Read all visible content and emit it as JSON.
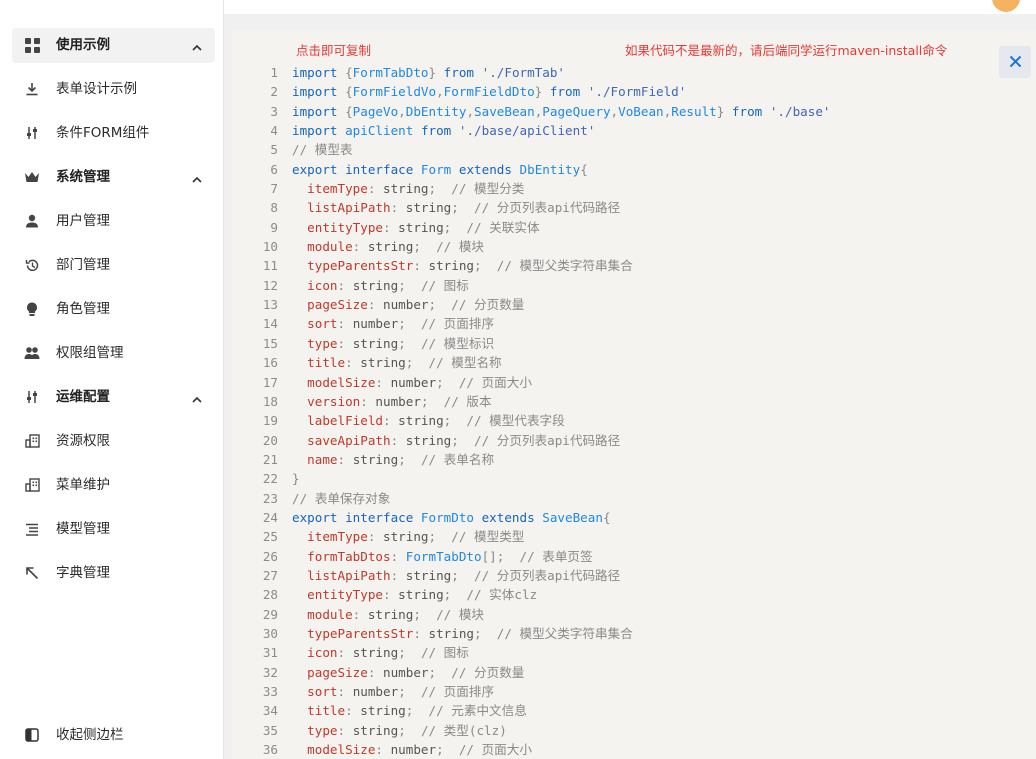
{
  "sidebar": {
    "items": [
      {
        "label": "使用示例",
        "icon": "dashboard-icon",
        "type": "group",
        "active": true
      },
      {
        "label": "表单设计示例",
        "icon": "download-icon",
        "type": "item"
      },
      {
        "label": "条件FORM组件",
        "icon": "slider-icon",
        "type": "item"
      },
      {
        "label": "系统管理",
        "icon": "crown-icon",
        "type": "group"
      },
      {
        "label": "用户管理",
        "icon": "user-icon",
        "type": "item"
      },
      {
        "label": "部门管理",
        "icon": "history-icon",
        "type": "item"
      },
      {
        "label": "角色管理",
        "icon": "bulb-icon",
        "type": "item"
      },
      {
        "label": "权限组管理",
        "icon": "team-icon",
        "type": "item"
      },
      {
        "label": "运维配置",
        "icon": "slider-icon",
        "type": "group"
      },
      {
        "label": "资源权限",
        "icon": "building-icon",
        "type": "item"
      },
      {
        "label": "菜单维护",
        "icon": "building-icon",
        "type": "item"
      },
      {
        "label": "模型管理",
        "icon": "list-icon",
        "type": "item"
      },
      {
        "label": "字典管理",
        "icon": "arrow-up-left-icon",
        "type": "item"
      }
    ],
    "collapse_label": "收起侧边栏"
  },
  "code_panel": {
    "copy_hint": "点击即可复制",
    "maven_hint": "如果代码不是最新的，请后端同学运行maven-install命令",
    "close_icon": "close-icon",
    "lines": [
      {
        "n": "1",
        "t": [
          [
            "kw",
            "import"
          ],
          [
            "pu",
            " {"
          ],
          [
            "ty",
            "FormTabDto"
          ],
          [
            "pu",
            "} "
          ],
          [
            "kw",
            "from"
          ],
          [
            "pl",
            " "
          ],
          [
            "str",
            "'./FormTab'"
          ]
        ]
      },
      {
        "n": "2",
        "t": [
          [
            "kw",
            "import"
          ],
          [
            "pu",
            " {"
          ],
          [
            "ty",
            "FormFieldVo"
          ],
          [
            "pu",
            ","
          ],
          [
            "ty",
            "FormFieldDto"
          ],
          [
            "pu",
            "} "
          ],
          [
            "kw",
            "from"
          ],
          [
            "pl",
            " "
          ],
          [
            "str",
            "'./FormField'"
          ]
        ]
      },
      {
        "n": "3",
        "t": [
          [
            "kw",
            "import"
          ],
          [
            "pu",
            " {"
          ],
          [
            "ty",
            "PageVo"
          ],
          [
            "pu",
            ","
          ],
          [
            "ty",
            "DbEntity"
          ],
          [
            "pu",
            ","
          ],
          [
            "ty",
            "SaveBean"
          ],
          [
            "pu",
            ","
          ],
          [
            "ty",
            "PageQuery"
          ],
          [
            "pu",
            ","
          ],
          [
            "ty",
            "VoBean"
          ],
          [
            "pu",
            ","
          ],
          [
            "ty",
            "Result"
          ],
          [
            "pu",
            "} "
          ],
          [
            "kw",
            "from"
          ],
          [
            "pl",
            " "
          ],
          [
            "str",
            "'./base'"
          ]
        ]
      },
      {
        "n": "4",
        "t": [
          [
            "kw",
            "import"
          ],
          [
            "pl",
            " "
          ],
          [
            "ty",
            "apiClient"
          ],
          [
            "pl",
            " "
          ],
          [
            "kw",
            "from"
          ],
          [
            "pl",
            " "
          ],
          [
            "str",
            "'./base/apiClient'"
          ]
        ]
      },
      {
        "n": "5",
        "t": [
          [
            "cm",
            "// 模型表"
          ]
        ]
      },
      {
        "n": "6",
        "t": [
          [
            "kw",
            "export interface"
          ],
          [
            "pl",
            " "
          ],
          [
            "ty",
            "Form"
          ],
          [
            "pl",
            " "
          ],
          [
            "kw",
            "extends"
          ],
          [
            "pl",
            " "
          ],
          [
            "ty",
            "DbEntity"
          ],
          [
            "pu",
            "{"
          ]
        ]
      },
      {
        "n": "7",
        "t": [
          [
            "pl",
            "  "
          ],
          [
            "pr",
            "itemType"
          ],
          [
            "pu",
            ": "
          ],
          [
            "pl",
            "string"
          ],
          [
            "pu",
            ";  "
          ],
          [
            "cm",
            "// 模型分类"
          ]
        ]
      },
      {
        "n": "8",
        "t": [
          [
            "pl",
            "  "
          ],
          [
            "pr",
            "listApiPath"
          ],
          [
            "pu",
            ": "
          ],
          [
            "pl",
            "string"
          ],
          [
            "pu",
            ";  "
          ],
          [
            "cm",
            "// 分页列表api代码路径"
          ]
        ]
      },
      {
        "n": "9",
        "t": [
          [
            "pl",
            "  "
          ],
          [
            "pr",
            "entityType"
          ],
          [
            "pu",
            ": "
          ],
          [
            "pl",
            "string"
          ],
          [
            "pu",
            ";  "
          ],
          [
            "cm",
            "// 关联实体"
          ]
        ]
      },
      {
        "n": "10",
        "t": [
          [
            "pl",
            "  "
          ],
          [
            "pr",
            "module"
          ],
          [
            "pu",
            ": "
          ],
          [
            "pl",
            "string"
          ],
          [
            "pu",
            ";  "
          ],
          [
            "cm",
            "// 模块"
          ]
        ]
      },
      {
        "n": "11",
        "t": [
          [
            "pl",
            "  "
          ],
          [
            "pr",
            "typeParentsStr"
          ],
          [
            "pu",
            ": "
          ],
          [
            "pl",
            "string"
          ],
          [
            "pu",
            ";  "
          ],
          [
            "cm",
            "// 模型父类字符串集合"
          ]
        ]
      },
      {
        "n": "12",
        "t": [
          [
            "pl",
            "  "
          ],
          [
            "pr",
            "icon"
          ],
          [
            "pu",
            ": "
          ],
          [
            "pl",
            "string"
          ],
          [
            "pu",
            ";  "
          ],
          [
            "cm",
            "// 图标"
          ]
        ]
      },
      {
        "n": "13",
        "t": [
          [
            "pl",
            "  "
          ],
          [
            "pr",
            "pageSize"
          ],
          [
            "pu",
            ": "
          ],
          [
            "pl",
            "number"
          ],
          [
            "pu",
            ";  "
          ],
          [
            "cm",
            "// 分页数量"
          ]
        ]
      },
      {
        "n": "14",
        "t": [
          [
            "pl",
            "  "
          ],
          [
            "pr",
            "sort"
          ],
          [
            "pu",
            ": "
          ],
          [
            "pl",
            "number"
          ],
          [
            "pu",
            ";  "
          ],
          [
            "cm",
            "// 页面排序"
          ]
        ]
      },
      {
        "n": "15",
        "t": [
          [
            "pl",
            "  "
          ],
          [
            "pr",
            "type"
          ],
          [
            "pu",
            ": "
          ],
          [
            "pl",
            "string"
          ],
          [
            "pu",
            ";  "
          ],
          [
            "cm",
            "// 模型标识"
          ]
        ]
      },
      {
        "n": "16",
        "t": [
          [
            "pl",
            "  "
          ],
          [
            "pr",
            "title"
          ],
          [
            "pu",
            ": "
          ],
          [
            "pl",
            "string"
          ],
          [
            "pu",
            ";  "
          ],
          [
            "cm",
            "// 模型名称"
          ]
        ]
      },
      {
        "n": "17",
        "t": [
          [
            "pl",
            "  "
          ],
          [
            "pr",
            "modelSize"
          ],
          [
            "pu",
            ": "
          ],
          [
            "pl",
            "number"
          ],
          [
            "pu",
            ";  "
          ],
          [
            "cm",
            "// 页面大小"
          ]
        ]
      },
      {
        "n": "18",
        "t": [
          [
            "pl",
            "  "
          ],
          [
            "pr",
            "version"
          ],
          [
            "pu",
            ": "
          ],
          [
            "pl",
            "number"
          ],
          [
            "pu",
            ";  "
          ],
          [
            "cm",
            "// 版本"
          ]
        ]
      },
      {
        "n": "19",
        "t": [
          [
            "pl",
            "  "
          ],
          [
            "pr",
            "labelField"
          ],
          [
            "pu",
            ": "
          ],
          [
            "pl",
            "string"
          ],
          [
            "pu",
            ";  "
          ],
          [
            "cm",
            "// 模型代表字段"
          ]
        ]
      },
      {
        "n": "20",
        "t": [
          [
            "pl",
            "  "
          ],
          [
            "pr",
            "saveApiPath"
          ],
          [
            "pu",
            ": "
          ],
          [
            "pl",
            "string"
          ],
          [
            "pu",
            ";  "
          ],
          [
            "cm",
            "// 分页列表api代码路径"
          ]
        ]
      },
      {
        "n": "21",
        "t": [
          [
            "pl",
            "  "
          ],
          [
            "pr",
            "name"
          ],
          [
            "pu",
            ": "
          ],
          [
            "pl",
            "string"
          ],
          [
            "pu",
            ";  "
          ],
          [
            "cm",
            "// 表单名称"
          ]
        ]
      },
      {
        "n": "22",
        "t": [
          [
            "pu",
            "}"
          ]
        ]
      },
      {
        "n": "23",
        "t": [
          [
            "cm",
            "// 表单保存对象"
          ]
        ]
      },
      {
        "n": "24",
        "t": [
          [
            "kw",
            "export interface"
          ],
          [
            "pl",
            " "
          ],
          [
            "ty",
            "FormDto"
          ],
          [
            "pl",
            " "
          ],
          [
            "kw",
            "extends"
          ],
          [
            "pl",
            " "
          ],
          [
            "ty",
            "SaveBean"
          ],
          [
            "pu",
            "{"
          ]
        ]
      },
      {
        "n": "25",
        "t": [
          [
            "pl",
            "  "
          ],
          [
            "pr",
            "itemType"
          ],
          [
            "pu",
            ": "
          ],
          [
            "pl",
            "string"
          ],
          [
            "pu",
            ";  "
          ],
          [
            "cm",
            "// 模型类型"
          ]
        ]
      },
      {
        "n": "26",
        "t": [
          [
            "pl",
            "  "
          ],
          [
            "pr",
            "formTabDtos"
          ],
          [
            "pu",
            ": "
          ],
          [
            "ty",
            "FormTabDto"
          ],
          [
            "pu",
            "[];  "
          ],
          [
            "cm",
            "// 表单页签"
          ]
        ]
      },
      {
        "n": "27",
        "t": [
          [
            "pl",
            "  "
          ],
          [
            "pr",
            "listApiPath"
          ],
          [
            "pu",
            ": "
          ],
          [
            "pl",
            "string"
          ],
          [
            "pu",
            ";  "
          ],
          [
            "cm",
            "// 分页列表api代码路径"
          ]
        ]
      },
      {
        "n": "28",
        "t": [
          [
            "pl",
            "  "
          ],
          [
            "pr",
            "entityType"
          ],
          [
            "pu",
            ": "
          ],
          [
            "pl",
            "string"
          ],
          [
            "pu",
            ";  "
          ],
          [
            "cm",
            "// 实体clz"
          ]
        ]
      },
      {
        "n": "29",
        "t": [
          [
            "pl",
            "  "
          ],
          [
            "pr",
            "module"
          ],
          [
            "pu",
            ": "
          ],
          [
            "pl",
            "string"
          ],
          [
            "pu",
            ";  "
          ],
          [
            "cm",
            "// 模块"
          ]
        ]
      },
      {
        "n": "30",
        "t": [
          [
            "pl",
            "  "
          ],
          [
            "pr",
            "typeParentsStr"
          ],
          [
            "pu",
            ": "
          ],
          [
            "pl",
            "string"
          ],
          [
            "pu",
            ";  "
          ],
          [
            "cm",
            "// 模型父类字符串集合"
          ]
        ]
      },
      {
        "n": "31",
        "t": [
          [
            "pl",
            "  "
          ],
          [
            "pr",
            "icon"
          ],
          [
            "pu",
            ": "
          ],
          [
            "pl",
            "string"
          ],
          [
            "pu",
            ";  "
          ],
          [
            "cm",
            "// 图标"
          ]
        ]
      },
      {
        "n": "32",
        "t": [
          [
            "pl",
            "  "
          ],
          [
            "pr",
            "pageSize"
          ],
          [
            "pu",
            ": "
          ],
          [
            "pl",
            "number"
          ],
          [
            "pu",
            ";  "
          ],
          [
            "cm",
            "// 分页数量"
          ]
        ]
      },
      {
        "n": "33",
        "t": [
          [
            "pl",
            "  "
          ],
          [
            "pr",
            "sort"
          ],
          [
            "pu",
            ": "
          ],
          [
            "pl",
            "number"
          ],
          [
            "pu",
            ";  "
          ],
          [
            "cm",
            "// 页面排序"
          ]
        ]
      },
      {
        "n": "34",
        "t": [
          [
            "pl",
            "  "
          ],
          [
            "pr",
            "title"
          ],
          [
            "pu",
            ": "
          ],
          [
            "pl",
            "string"
          ],
          [
            "pu",
            ";  "
          ],
          [
            "cm",
            "// 元素中文信息"
          ]
        ]
      },
      {
        "n": "35",
        "t": [
          [
            "pl",
            "  "
          ],
          [
            "pr",
            "type"
          ],
          [
            "pu",
            ": "
          ],
          [
            "pl",
            "string"
          ],
          [
            "pu",
            ";  "
          ],
          [
            "cm",
            "// 类型(clz)"
          ]
        ]
      },
      {
        "n": "36",
        "t": [
          [
            "pl",
            "  "
          ],
          [
            "pr",
            "modelSize"
          ],
          [
            "pu",
            ": "
          ],
          [
            "pl",
            "number"
          ],
          [
            "pu",
            ";  "
          ],
          [
            "cm",
            "// 页面大小"
          ]
        ]
      }
    ]
  },
  "colors": {
    "accent_red": "#e53935",
    "keyword_blue": "#1565c0",
    "property_red": "#c0392b",
    "code_bg": "#f5f3ef"
  }
}
